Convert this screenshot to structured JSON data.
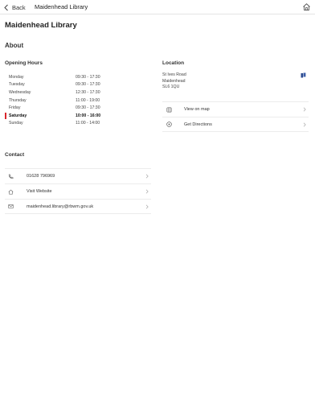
{
  "navbar": {
    "back_label": "Back",
    "title": "Maidenhead Library"
  },
  "page": {
    "title": "Maidenhead Library",
    "about_heading": "About"
  },
  "hours": {
    "heading": "Opening Hours",
    "rows": [
      {
        "day": "Monday",
        "time": "09:30 - 17:30"
      },
      {
        "day": "Tuesday",
        "time": "09:30 - 17:30"
      },
      {
        "day": "Wednesday",
        "time": "12:30 - 17:30"
      },
      {
        "day": "Thursday",
        "time": "11:00 - 19:00"
      },
      {
        "day": "Friday",
        "time": "09:30 - 17:30"
      },
      {
        "day": "Saturday",
        "time": "10:00 - 16:00"
      },
      {
        "day": "Sunday",
        "time": "11:00 - 14:00"
      }
    ],
    "highlight_color": "#d9262c"
  },
  "location": {
    "heading": "Location",
    "address_line1": "St Ives Road",
    "address_line2": "Maidenhead",
    "address_line3": "SL6 1QU",
    "view_on_map_label": "View on map",
    "get_directions_label": "Get Directions",
    "pin_color": "#2b4a8f"
  },
  "contact": {
    "heading": "Contact",
    "phone": "01628 796969",
    "website_label": "Visit Website",
    "email": "maidenhead.library@rbwm.gov.uk"
  }
}
